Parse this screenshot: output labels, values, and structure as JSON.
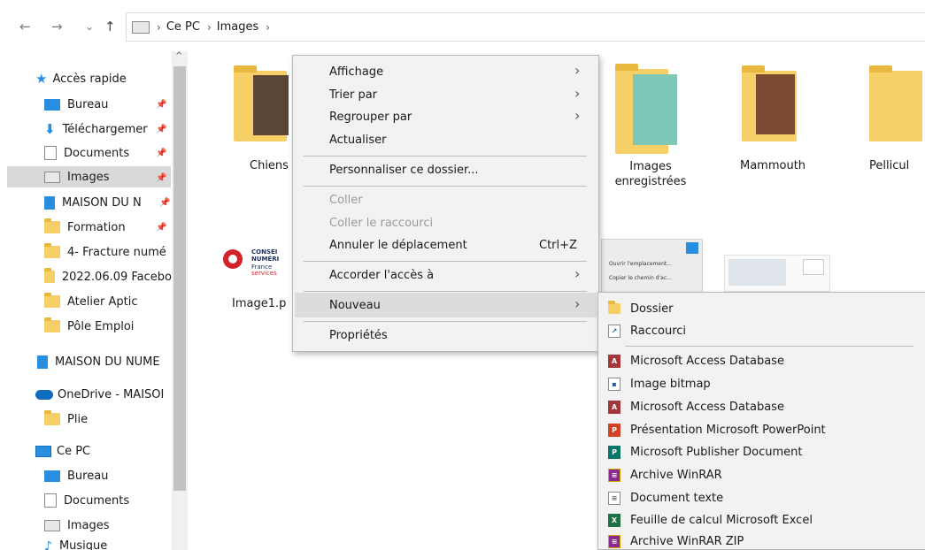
{
  "nav": {
    "back": "←",
    "forward": "→",
    "recent": "⌄",
    "up": "↑",
    "breadcrumb": [
      "Ce PC",
      "Images"
    ],
    "sep": "›"
  },
  "sidebar": {
    "quick_access": "Accès rapide",
    "items": [
      {
        "label": "Bureau",
        "icon": "desktop-icon"
      },
      {
        "label": "Téléchargemer",
        "icon": "download-icon"
      },
      {
        "label": "Documents",
        "icon": "documents-icon"
      },
      {
        "label": "Images",
        "icon": "pictures-icon"
      },
      {
        "label": "MAISON DU N",
        "icon": "network-icon"
      },
      {
        "label": "Formation",
        "icon": "folder-icon"
      },
      {
        "label": "4- Fracture numé",
        "icon": "folder-icon"
      },
      {
        "label": "2022.06.09 Facebo",
        "icon": "folder-icon"
      },
      {
        "label": "Atelier Aptic",
        "icon": "folder-icon"
      },
      {
        "label": "Pôle Emploi",
        "icon": "folder-icon"
      }
    ],
    "maison": "MAISON DU NUME",
    "onedrive": "OneDrive - MAISOI",
    "plie": "Plie",
    "ce_pc": "Ce PC",
    "pc_items": [
      "Bureau",
      "Documents",
      "Images",
      "Musique"
    ]
  },
  "content": {
    "tiles": [
      "Chiens",
      "Images\nenregistrées",
      "Mammouth",
      "Pellicul"
    ],
    "file1": "Image1.p",
    "cns_line1": "CONSEI",
    "cns_line2": "NUMÉRI",
    "cns_line3": "France",
    "cns_line4": "services",
    "thumb_text1": "Ouvrir l'emplacement...",
    "thumb_text2": "Copier le chemin d'ac..."
  },
  "menu": {
    "affichage": "Affichage",
    "trier": "Trier par",
    "regrouper": "Regrouper par",
    "actualiser": "Actualiser",
    "personnaliser": "Personnaliser ce dossier...",
    "coller": "Coller",
    "coller_raccourci": "Coller le raccourci",
    "annuler": "Annuler le déplacement",
    "annuler_shortcut": "Ctrl+Z",
    "accorder": "Accorder l'accès à",
    "nouveau": "Nouveau",
    "proprietes": "Propriétés"
  },
  "submenu": {
    "items": [
      {
        "label": "Dossier",
        "icon": "folder-icon"
      },
      {
        "label": "Raccourci",
        "icon": "shortcut-icon"
      },
      {
        "label": "Microsoft Access Database",
        "icon": "access-icon"
      },
      {
        "label": "Image bitmap",
        "icon": "bitmap-icon"
      },
      {
        "label": "Microsoft Access Database",
        "icon": "access-icon"
      },
      {
        "label": "Présentation Microsoft PowerPoint",
        "icon": "powerpoint-icon"
      },
      {
        "label": "Microsoft Publisher Document",
        "icon": "publisher-icon"
      },
      {
        "label": "Archive WinRAR",
        "icon": "winrar-icon"
      },
      {
        "label": "Document texte",
        "icon": "text-document-icon"
      },
      {
        "label": "Feuille de calcul Microsoft Excel",
        "icon": "excel-icon"
      },
      {
        "label": "Archive WinRAR ZIP",
        "icon": "winrar-zip-icon"
      }
    ]
  },
  "colors": {
    "accent": "#2a8ee0",
    "folder": "#f6cf66",
    "menu_bg": "#f2f2f2",
    "highlight": "#dcdcdc"
  }
}
